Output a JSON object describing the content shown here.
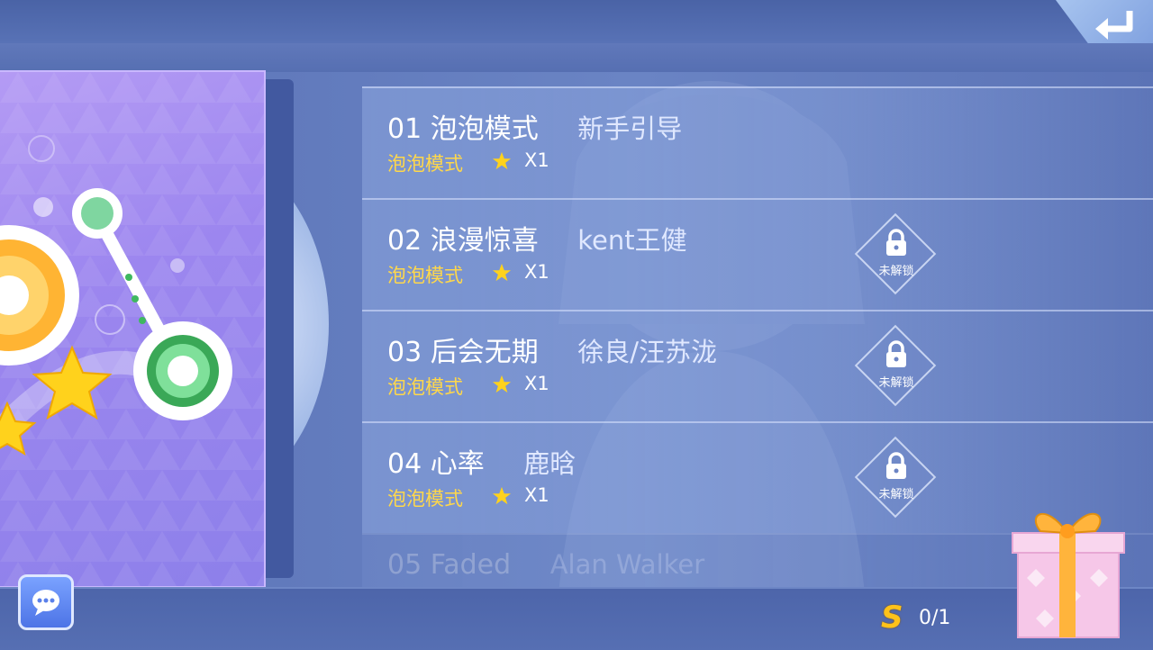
{
  "header": {
    "back_icon": "return-arrow-icon"
  },
  "songs": [
    {
      "number": "01",
      "title": "泡泡模式",
      "artist": "新手引导",
      "mode": "泡泡模式",
      "multiplier": "X1",
      "locked": false,
      "lock_label": ""
    },
    {
      "number": "02",
      "title": "浪漫惊喜",
      "artist": "kent王健",
      "mode": "泡泡模式",
      "multiplier": "X1",
      "locked": true,
      "lock_label": "未解锁"
    },
    {
      "number": "03",
      "title": "后会无期",
      "artist": "徐良/汪苏泷",
      "mode": "泡泡模式",
      "multiplier": "X1",
      "locked": true,
      "lock_label": "未解锁"
    },
    {
      "number": "04",
      "title": "心率",
      "artist": "鹿晗",
      "mode": "泡泡模式",
      "multiplier": "X1",
      "locked": true,
      "lock_label": "未解锁"
    },
    {
      "number": "05",
      "title": "Faded",
      "artist": "Alan Walker"
    }
  ],
  "score": {
    "icon": "S",
    "value": "0/1"
  },
  "colors": {
    "mode_text": "#ffd84a",
    "star": "#ffd21c",
    "score_icon": "#ffc21a"
  }
}
